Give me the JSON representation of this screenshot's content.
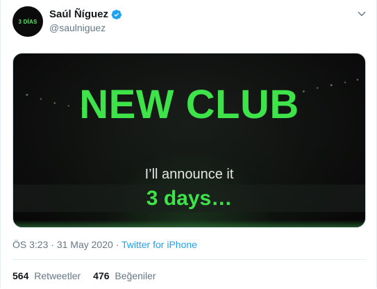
{
  "tweet": {
    "avatar_text": "3 DÍAS",
    "display_name": "Saúl Ñíguez",
    "handle": "@saulniguez",
    "verified": true,
    "media": {
      "headline": "NEW CLUB",
      "subline": "I’ll announce it",
      "days_text": "3 days…"
    },
    "time": "ÖS 3:23",
    "separator": "·",
    "date": "31 May 2020",
    "separator2": "·",
    "source": "Twitter for iPhone",
    "retweets_count": "564",
    "retweets_label": "Retweetler",
    "likes_count": "476",
    "likes_label": "Beğeniler"
  },
  "colors": {
    "accent": "#1da1f2",
    "headline_green": "#3ee34a",
    "muted": "#657786"
  },
  "icons": {
    "verified": "verified-badge-icon",
    "caret": "chevron-down-icon"
  }
}
